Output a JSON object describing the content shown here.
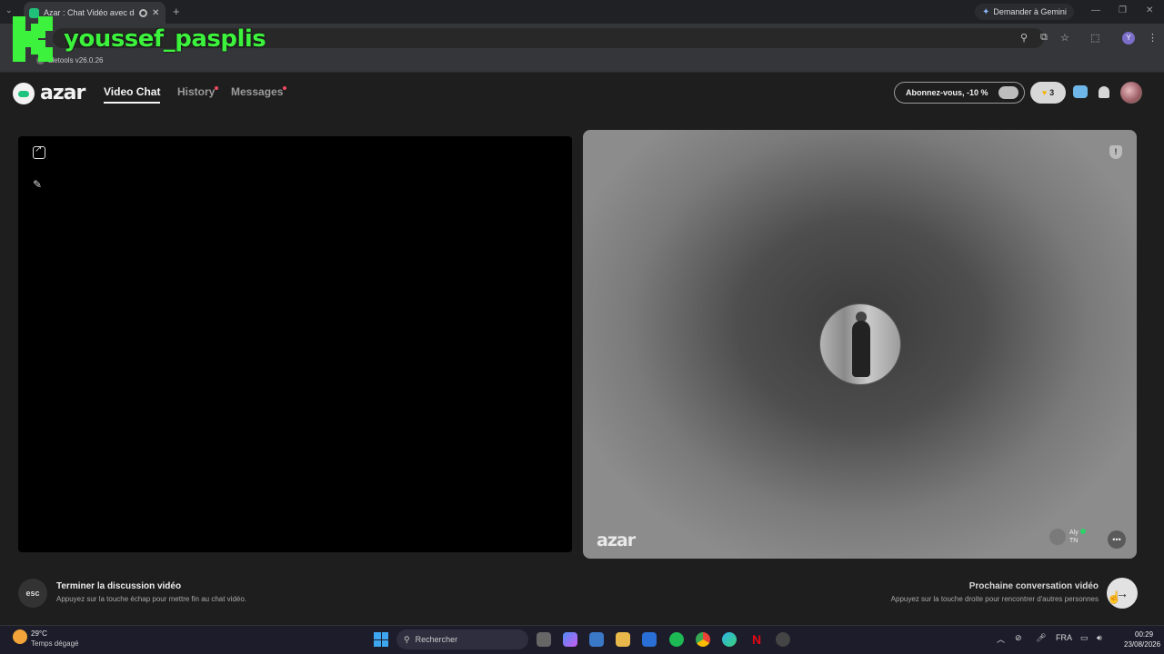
{
  "browser": {
    "tab_title": "Azar : Chat Vidéo avec de n",
    "new_tab": "+",
    "gemini_label": "Demander à Gemini",
    "profile_initial": "Y",
    "bookmark_label": "aletools v26.0.26"
  },
  "overlay": {
    "channel_name": "youssef_pasplis",
    "brand_color": "#3cf23c"
  },
  "app": {
    "brand": "azar",
    "nav": {
      "video_chat": "Video Chat",
      "history": "History",
      "messages": "Messages"
    },
    "subscribe_label": "Abonnez-vous, -10 %",
    "gem_count": "3",
    "peer": {
      "watermark": "azar",
      "id": "#azrQskOf",
      "name": "Aly",
      "country": "TN"
    },
    "end_chat": {
      "key": "esc",
      "title": "Terminer la discussion vidéo",
      "subtitle": "Appuyez sur la touche échap pour mettre fin au chat vidéo."
    },
    "next_chat": {
      "title": "Prochaine conversation vidéo",
      "subtitle": "Appuyez sur la touche droite pour rencontrer d'autres personnes"
    },
    "accent_color": "#1ec47e"
  },
  "taskbar": {
    "weather_temp": "29°C",
    "weather_desc": "Temps dégagé",
    "search_placeholder": "Rechercher",
    "language": "FRA",
    "time": "00:29",
    "date": "23/08/2026"
  }
}
